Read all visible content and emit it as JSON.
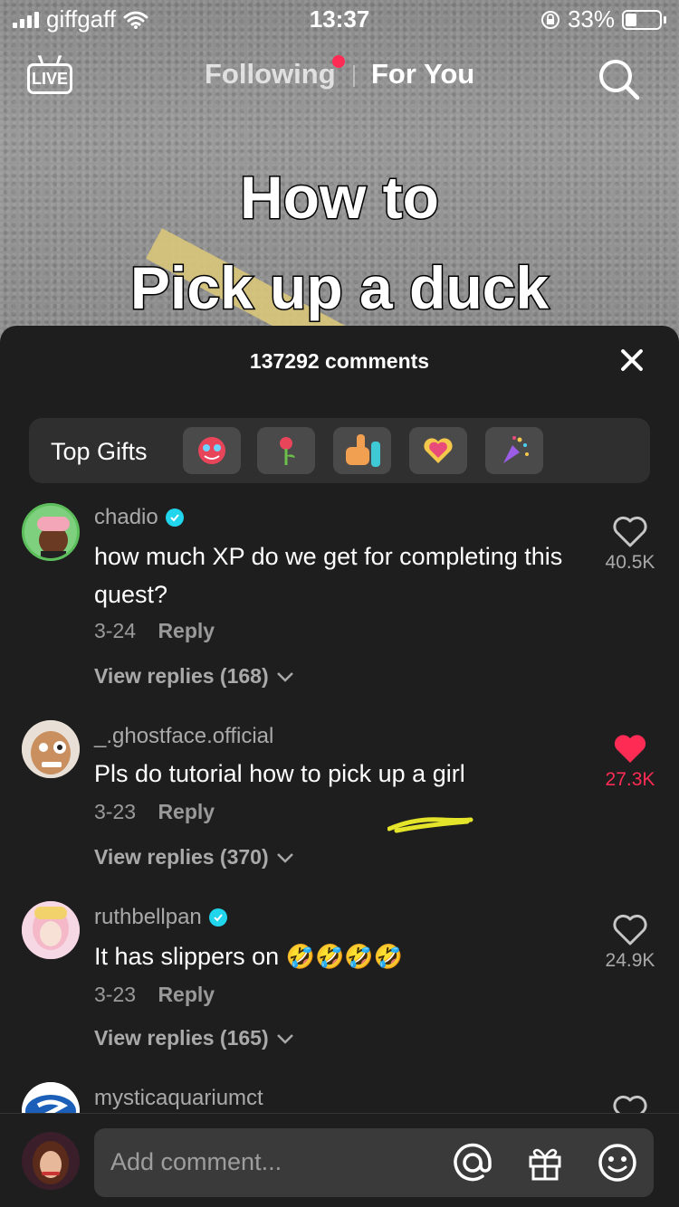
{
  "status_bar": {
    "carrier": "giffgaff",
    "time": "13:37",
    "battery": "33%"
  },
  "nav": {
    "live_label": "LIVE",
    "following": "Following",
    "for_you": "For You"
  },
  "video": {
    "title_line1": "How to",
    "title_line2": "Pick up a duck"
  },
  "comments_sheet": {
    "header": "137292 comments",
    "top_gifts_label": "Top Gifts",
    "gifts": [
      "mask-gift",
      "rose-gift",
      "thumbs-up-gift",
      "heart-gift",
      "confetti-gift"
    ]
  },
  "comments": [
    {
      "username": "chadio",
      "verified": true,
      "text": "how much XP do we get for completing this quest?",
      "date": "3-24",
      "reply": "Reply",
      "view_replies": "View replies (168)",
      "likes": "40.5K",
      "liked": false
    },
    {
      "username": "_.ghostface.official",
      "verified": false,
      "text": "Pls do tutorial how to pick up a girl",
      "date": "3-23",
      "reply": "Reply",
      "view_replies": "View replies (370)",
      "likes": "27.3K",
      "liked": true
    },
    {
      "username": "ruthbellpan",
      "verified": true,
      "text": "It has slippers on",
      "emojis": "🤣🤣🤣🤣",
      "date": "3-23",
      "reply": "Reply",
      "view_replies": "View replies (165)",
      "likes": "24.9K",
      "liked": false
    },
    {
      "username": "mysticaquariumct",
      "verified": false
    }
  ],
  "composer": {
    "placeholder": "Add comment..."
  },
  "colors": {
    "accent": "#fe2c55",
    "verified": "#20d5ec",
    "sheet_bg": "#1e1e1e"
  }
}
